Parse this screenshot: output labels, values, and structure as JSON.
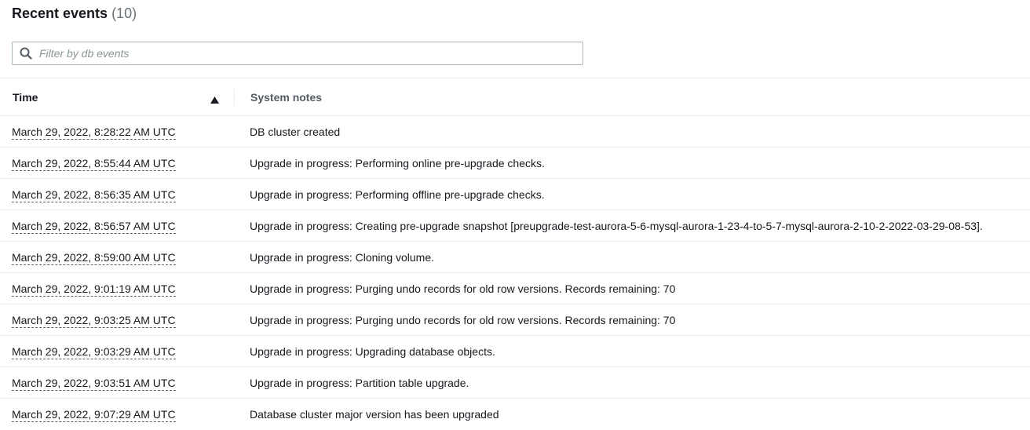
{
  "header": {
    "title": "Recent events",
    "count": "(10)"
  },
  "filter": {
    "placeholder": "Filter by db events",
    "value": ""
  },
  "table": {
    "columns": {
      "time": "Time",
      "notes": "System notes"
    },
    "sort": {
      "column": "time",
      "direction": "ascending"
    },
    "rows": [
      {
        "time": "March 29, 2022, 8:28:22 AM UTC",
        "notes": "DB cluster created"
      },
      {
        "time": "March 29, 2022, 8:55:44 AM UTC",
        "notes": "Upgrade in progress: Performing online pre-upgrade checks."
      },
      {
        "time": "March 29, 2022, 8:56:35 AM UTC",
        "notes": "Upgrade in progress: Performing offline pre-upgrade checks."
      },
      {
        "time": "March 29, 2022, 8:56:57 AM UTC",
        "notes": "Upgrade in progress: Creating pre-upgrade snapshot [preupgrade-test-aurora-5-6-mysql-aurora-1-23-4-to-5-7-mysql-aurora-2-10-2-2022-03-29-08-53]."
      },
      {
        "time": "March 29, 2022, 8:59:00 AM UTC",
        "notes": "Upgrade in progress: Cloning volume."
      },
      {
        "time": "March 29, 2022, 9:01:19 AM UTC",
        "notes": "Upgrade in progress: Purging undo records for old row versions. Records remaining: 70"
      },
      {
        "time": "March 29, 2022, 9:03:25 AM UTC",
        "notes": "Upgrade in progress: Purging undo records for old row versions. Records remaining: 70"
      },
      {
        "time": "March 29, 2022, 9:03:29 AM UTC",
        "notes": "Upgrade in progress: Upgrading database objects."
      },
      {
        "time": "March 29, 2022, 9:03:51 AM UTC",
        "notes": "Upgrade in progress: Partition table upgrade."
      },
      {
        "time": "March 29, 2022, 9:07:29 AM UTC",
        "notes": "Database cluster major version has been upgraded"
      }
    ]
  },
  "icons": {
    "search": "search-icon",
    "sort": "caret-up-icon"
  },
  "colors": {
    "text": "#16191f",
    "muted": "#687078",
    "border": "#eaeded",
    "input_border": "#aab7b8"
  }
}
